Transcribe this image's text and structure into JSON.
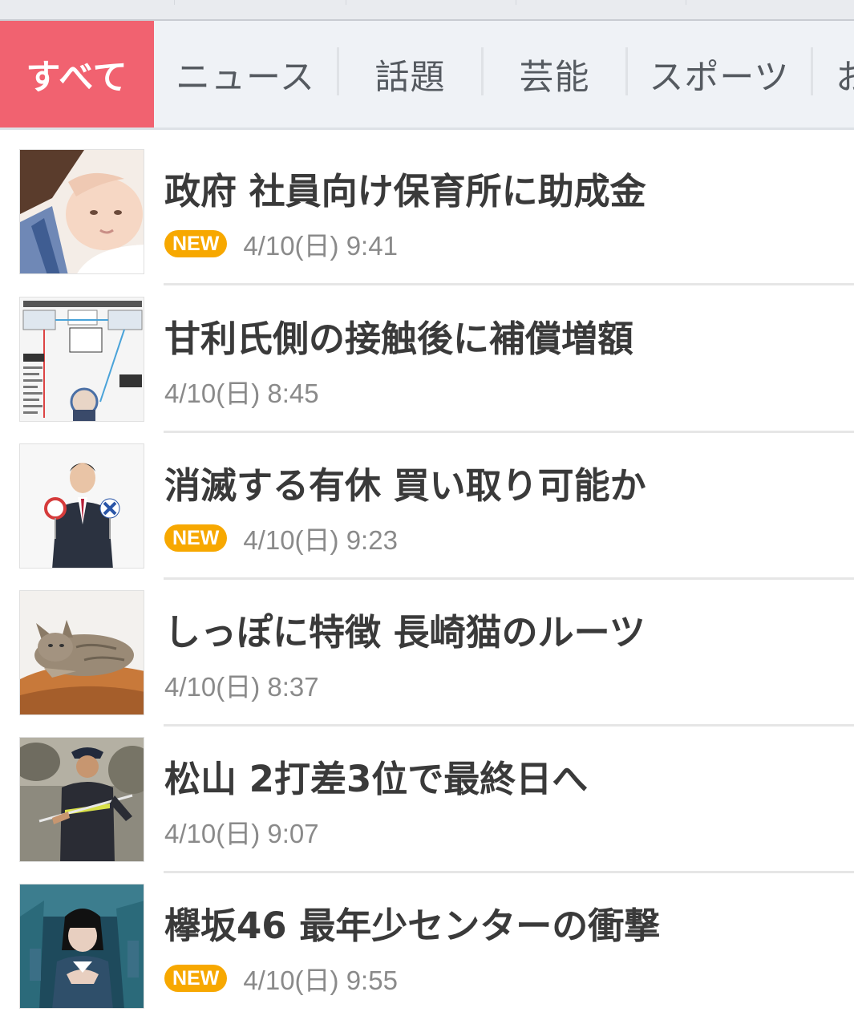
{
  "tabs": [
    {
      "label": "すべて",
      "active": true
    },
    {
      "label": "ニュース",
      "active": false
    },
    {
      "label": "話題",
      "active": false
    },
    {
      "label": "芸能",
      "active": false
    },
    {
      "label": "スポーツ",
      "active": false
    },
    {
      "label": "お",
      "active": false
    }
  ],
  "news": [
    {
      "title": "政府 社員向け保育所に助成金",
      "time": "4/10(日) 9:41",
      "badge": "NEW",
      "thumb": "parent-kissing-baby"
    },
    {
      "title": "甘利氏側の接触後に補償増額",
      "time": "4/10(日) 8:45",
      "badge": "",
      "thumb": "relationship-diagram"
    },
    {
      "title": "消滅する有休 買い取り可能か",
      "time": "4/10(日) 9:23",
      "badge": "NEW",
      "thumb": "man-holding-circle-cross-signs"
    },
    {
      "title": "しっぽに特徴 長崎猫のルーツ",
      "time": "4/10(日) 8:37",
      "badge": "",
      "thumb": "cat-lying"
    },
    {
      "title": "松山 2打差3位で最終日へ",
      "time": "4/10(日) 9:07",
      "badge": "",
      "thumb": "golfer"
    },
    {
      "title": "欅坂46 最年少センターの衝撃",
      "time": "4/10(日) 9:55",
      "badge": "NEW",
      "thumb": "idol-performer"
    }
  ],
  "colors": {
    "active_tab": "#f16270",
    "badge": "#f7a800",
    "tabbar_bg": "#eff2f6"
  }
}
